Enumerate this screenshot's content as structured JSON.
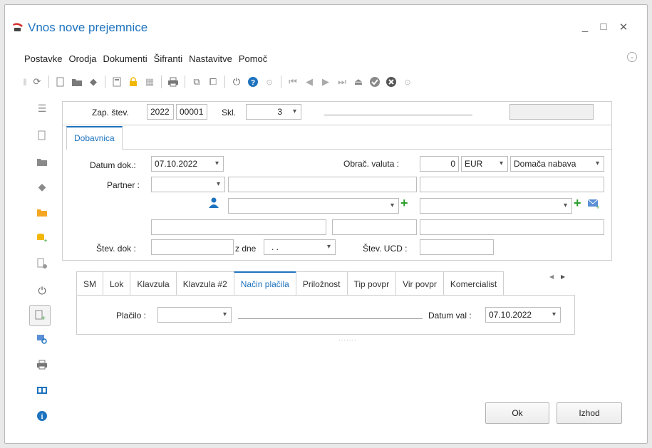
{
  "window": {
    "title": "Vnos nove prejemnice",
    "controls": [
      "_",
      "□",
      "✕"
    ]
  },
  "menu": {
    "items": [
      {
        "label": "Postavke"
      },
      {
        "label": "Orodja"
      },
      {
        "label": "Dokumenti"
      },
      {
        "label": "Šifranti"
      },
      {
        "label": "Nastavitve"
      },
      {
        "label": "Pomoč"
      }
    ]
  },
  "header": {
    "zap_label": "Zap. štev.",
    "zap_year": "2022",
    "zap_number": "00001",
    "skl_label": "Skl.",
    "skl_value": "3"
  },
  "tabs": {
    "main": "Dobavnica"
  },
  "form": {
    "datum_dok_label": "Datum dok.:",
    "datum_dok_value": "07.10.2022",
    "obrac_valuta_label": "Obrač. valuta :",
    "obrac_valuta_value": "0",
    "currency": "EUR",
    "nabava": "Domača nabava",
    "partner_label": "Partner :",
    "stev_dok_label": "Štev. dok :",
    "z_dne_label": "z dne",
    "z_dne_value": ". .",
    "stev_ucd_label": "Štev. UCD :"
  },
  "lower_tabs": {
    "items": [
      "SM",
      "Lok",
      "Klavzula",
      "Klavzula #2",
      "Način plačila",
      "Priložnost",
      "Tip povpr",
      "Vir povpr",
      "Komercialist"
    ],
    "active": "Način plačila"
  },
  "payment": {
    "placilo_label": "Plačilo :",
    "datum_val_label": "Datum val :",
    "datum_val_value": "07.10.2022"
  },
  "buttons": {
    "ok": "Ok",
    "exit": "Izhod"
  },
  "colors": {
    "accent": "#1e73be",
    "green": "#2a9d2a",
    "orange": "#f5a623"
  }
}
